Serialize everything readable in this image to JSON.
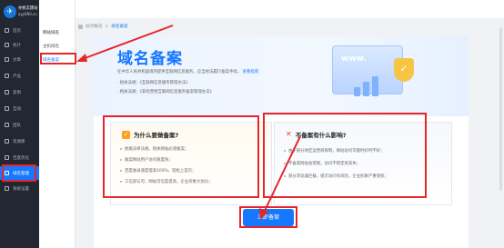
{
  "logo": {
    "name": "亦帆云建站",
    "domain": "ayy990.cn"
  },
  "sidebar": {
    "items": [
      {
        "label": "首页",
        "icon": "home-icon"
      },
      {
        "label": "统计",
        "icon": "chart-icon"
      },
      {
        "label": "文章",
        "icon": "doc-icon"
      },
      {
        "label": "产品",
        "icon": "box-icon"
      },
      {
        "label": "案例",
        "icon": "case-icon"
      },
      {
        "label": "互动",
        "icon": "chat-icon"
      },
      {
        "label": "团队",
        "icon": "team-icon"
      },
      {
        "label": "资源库",
        "icon": "folder-icon"
      },
      {
        "label": "百度优化",
        "icon": "seo-icon"
      },
      {
        "label": "域名管理",
        "icon": "globe-icon",
        "active": true
      },
      {
        "label": "系统设置",
        "icon": "gear-icon"
      }
    ]
  },
  "submenu": {
    "group": "网站域名",
    "items": [
      {
        "label": "主机域名"
      },
      {
        "label": "域名备案",
        "selected": true
      }
    ]
  },
  "breadcrumb": {
    "root": "站点概况",
    "sep": ">",
    "current": "域名备案"
  },
  "hero": {
    "title": "域名备案",
    "desc": "在中华人民共和国境内提供互联网信息服务，应当依法履行备案手续。",
    "desc_link": "查看指南",
    "laws": [
      "· 相关法规：《互联网信息服务管理办法》",
      "· 相关法规：《非经营性互联网信息服务备案管理办法》"
    ],
    "illus_text": "www."
  },
  "why": {
    "title": "为什么要做备案?",
    "points": [
      "依据法律法规，相关网站必须备案；",
      "备案网站用户访问速度快；",
      "百度收录速度提高100%，轻松上首页；",
      "工信部认可，网站可信度提高，企业形象大加分；"
    ]
  },
  "no_record": {
    "title": "不备案有什么影响?",
    "points": [
      "由于部分地区运营商限制，网站访问可能时好时不好；",
      "不备案网站会受限，访问不稳定易丢失；",
      "部分浏览器拦截，提示访问有风险，企业形象严重受损；"
    ]
  },
  "actions": {
    "apply_label": "立即备案"
  },
  "colors": {
    "accent": "#1677ff",
    "annotation": "#e5262b",
    "sidebar": "#222731"
  }
}
